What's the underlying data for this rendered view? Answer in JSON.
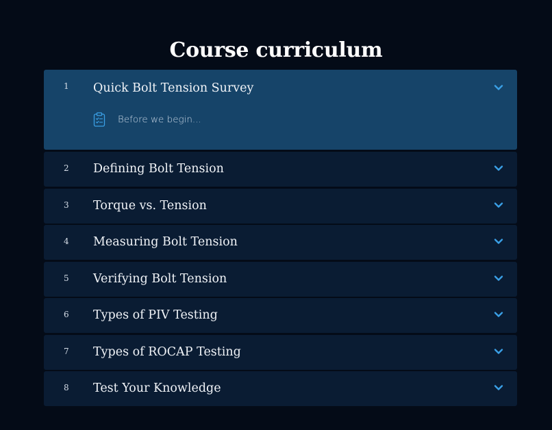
{
  "page": {
    "title": "Course curriculum"
  },
  "colors": {
    "background": "#040b17",
    "module_collapsed": "#0a1c33",
    "module_expanded": "#164469",
    "accent": "#3aa0e6"
  },
  "modules": [
    {
      "number": "1",
      "title": "Quick Bolt Tension Survey",
      "expanded": true,
      "lessons": [
        {
          "icon": "clipboard-checklist-icon",
          "title": "Before we begin..."
        }
      ]
    },
    {
      "number": "2",
      "title": "Defining Bolt Tension",
      "expanded": false
    },
    {
      "number": "3",
      "title": "Torque vs. Tension",
      "expanded": false
    },
    {
      "number": "4",
      "title": "Measuring Bolt Tension",
      "expanded": false
    },
    {
      "number": "5",
      "title": "Verifying Bolt Tension",
      "expanded": false
    },
    {
      "number": "6",
      "title": "Types of PIV Testing",
      "expanded": false
    },
    {
      "number": "7",
      "title": "Types of ROCAP Testing",
      "expanded": false
    },
    {
      "number": "8",
      "title": "Test Your Knowledge",
      "expanded": false
    }
  ]
}
